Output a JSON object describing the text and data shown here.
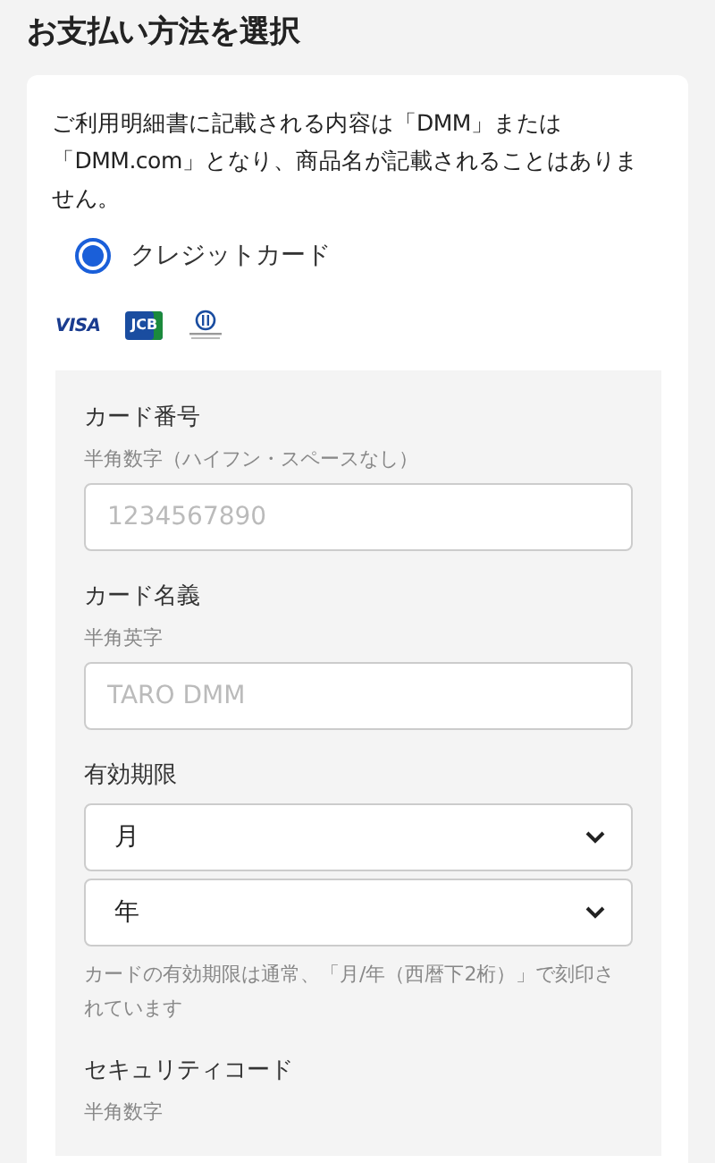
{
  "page_title": "お支払い方法を選択",
  "notice": "ご利用明細書に記載される内容は「DMM」または「DMM.com」となり、商品名が記載されることはありません。",
  "payment_methods": [
    {
      "label": "クレジットカード",
      "selected": true
    }
  ],
  "card_brands": [
    {
      "kind": "visa",
      "text": "VISA"
    },
    {
      "kind": "jcb",
      "text": "JCB"
    },
    {
      "kind": "diners"
    }
  ],
  "fields": [
    {
      "kind": "text",
      "label": "カード番号",
      "hint": "半角数字（ハイフン・スペースなし）",
      "placeholder": "1234567890"
    },
    {
      "kind": "text",
      "label": "カード名義",
      "hint": "半角英字",
      "placeholder": "TARO DMM"
    },
    {
      "kind": "select",
      "label": "有効期限",
      "selects": [
        "月",
        "年"
      ],
      "note": "カードの有効期限は通常、「月/年（西暦下2桁）」で刻印されています"
    },
    {
      "kind": "text",
      "label": "セキュリティコード",
      "hint": "半角数字"
    }
  ]
}
